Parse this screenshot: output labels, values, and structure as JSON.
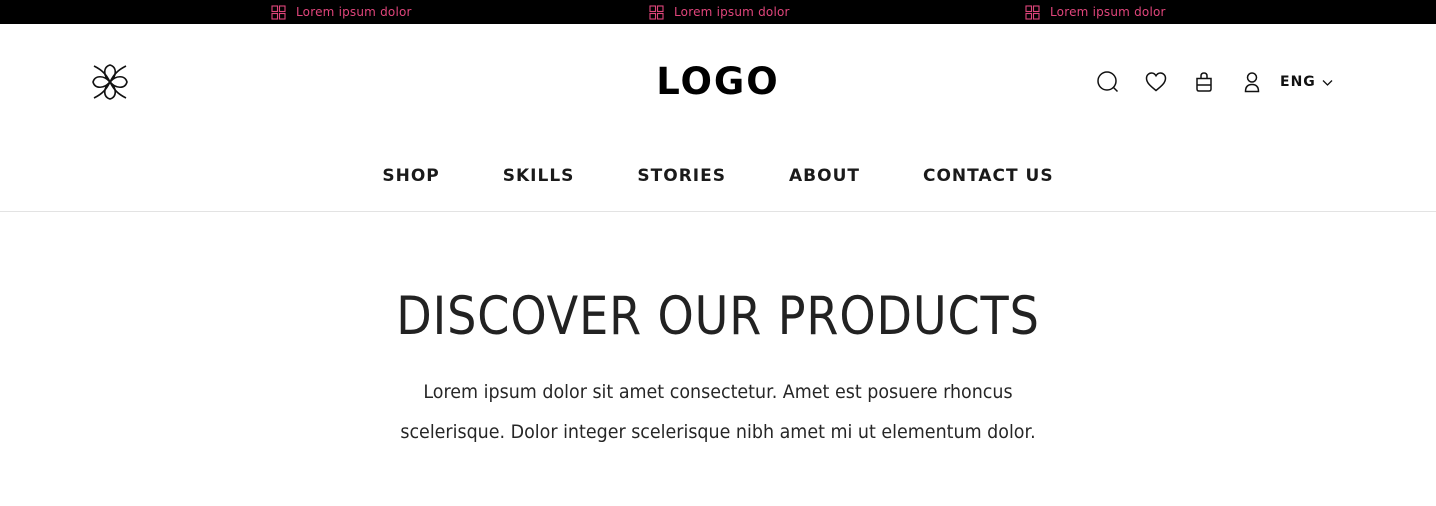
{
  "colors": {
    "topbar_bg": "#000000",
    "topbar_accent": "#e0457b",
    "text": "#1a1a1a",
    "divider": "#e3e3e3"
  },
  "announcement": {
    "items": [
      {
        "icon": "grid-icon",
        "text": "Lorem ipsum dolor"
      },
      {
        "icon": "grid-icon",
        "text": "Lorem ipsum dolor"
      },
      {
        "icon": "grid-icon",
        "text": "Lorem ipsum dolor"
      }
    ]
  },
  "header": {
    "brand_icon": "flower-knot-icon",
    "logo": "LOGO",
    "actions": [
      {
        "icon": "search-icon"
      },
      {
        "icon": "heart-icon"
      },
      {
        "icon": "bag-icon"
      },
      {
        "icon": "user-icon"
      }
    ],
    "language": {
      "label": "ENG",
      "icon": "chevron-down-icon"
    }
  },
  "nav": {
    "items": [
      {
        "label": "SHOP"
      },
      {
        "label": "SKILLS"
      },
      {
        "label": "STORIES"
      },
      {
        "label": "ABOUT"
      },
      {
        "label": "CONTACT US"
      }
    ]
  },
  "hero": {
    "title": "DISCOVER OUR PRODUCTS",
    "description": "Lorem ipsum dolor sit amet consectetur. Amet est posuere rhoncus scelerisque. Dolor integer scelerisque nibh amet mi ut elementum dolor."
  }
}
